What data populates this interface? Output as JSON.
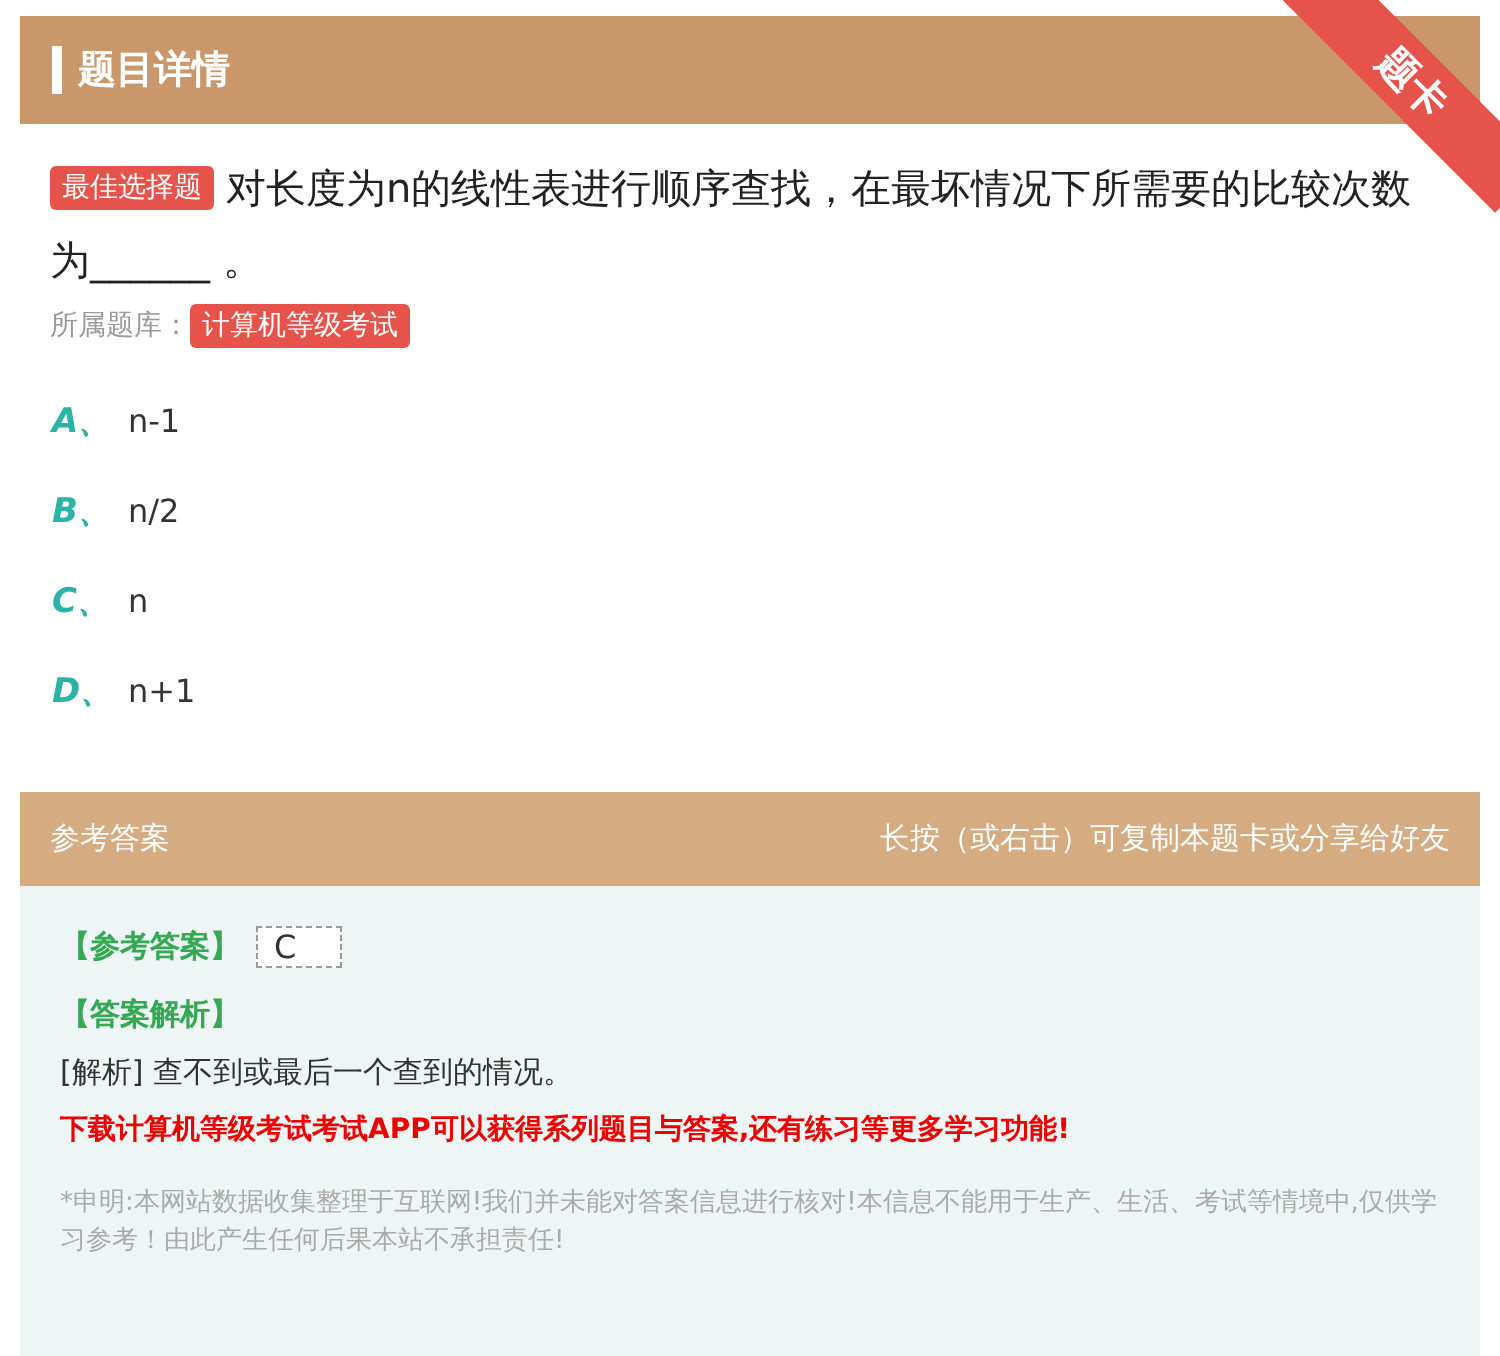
{
  "header": {
    "title": "题目详情",
    "ribbon": "题卡"
  },
  "question": {
    "type_tag": "最佳选择题",
    "text": "对长度为n的线性表进行顺序查找，在最坏情况下所需要的比较次数为______ 。",
    "bank_label": "所属题库：",
    "bank_tag": "计算机等级考试"
  },
  "options": [
    {
      "letter": "A、",
      "text": "n-1"
    },
    {
      "letter": "B、",
      "text": "n/2"
    },
    {
      "letter": "C、",
      "text": "n"
    },
    {
      "letter": "D、",
      "text": "n+1"
    }
  ],
  "answer_bar": {
    "title": "参考答案",
    "hint": "长按（或右击）可复制本题卡或分享给好友"
  },
  "answer": {
    "label": "【参考答案】",
    "value": "C",
    "analysis_label": "【答案解析】",
    "analysis": "[解析] 查不到或最后一个查到的情况。",
    "promo": "下载计算机等级考试考试APP可以获得系列题目与答案,还有练习等更多学习功能!",
    "disclaimer": "*申明:本网站数据收集整理于互联网!我们并未能对答案信息进行核对!本信息不能用于生产、生活、考试等情境中,仅供学习参考！由此产生任何后果本站不承担责任!"
  }
}
